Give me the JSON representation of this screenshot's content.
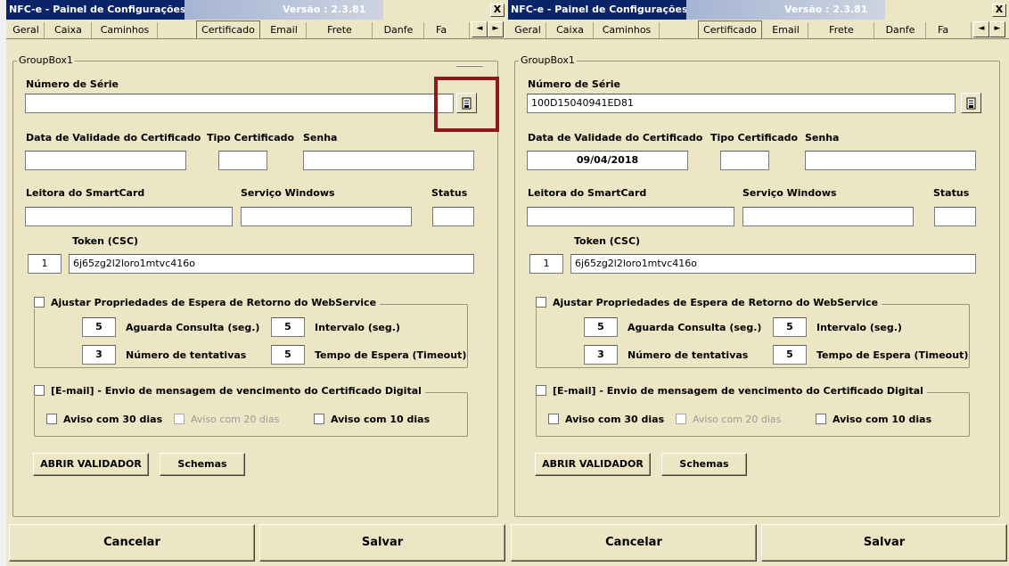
{
  "window": {
    "title": "NFC-e - Painel de Configurações",
    "version": "Versão : 2.3.81",
    "close_label": "X"
  },
  "tabs": [
    "Geral",
    "Caixa",
    "Caminhos",
    "Certificado",
    "Email",
    "Frete",
    "Danfe",
    "Fa"
  ],
  "active_tab": "Certificado",
  "scroll": {
    "left": "◄",
    "right": "►"
  },
  "groupbox": {
    "title": "GroupBox1"
  },
  "labels": {
    "serial_number": "Número de Série",
    "validity": "Data de Validade do Certificado",
    "cert_type": "Tipo Certificado",
    "password": "Senha",
    "smartcard_reader": "Leitora do SmartCard",
    "windows_service": "Serviço Windows",
    "status": "Status",
    "token": "Token (CSC)"
  },
  "webservice": {
    "title": "Ajustar Propriedades de Espera de Retorno do WebService",
    "fields": [
      {
        "label": "Aguarda Consulta (seg.)",
        "value": "5"
      },
      {
        "label": "Intervalo (seg.)",
        "value": "5"
      },
      {
        "label": "Número de tentativas",
        "value": "3"
      },
      {
        "label": "Tempo de Espera (Timeout)",
        "value": "5"
      }
    ]
  },
  "email_section": {
    "title": "[E-mail]  - Envio de mensagem de vencimento do Certificado Digital",
    "options": [
      "Aviso com 30 dias",
      "Aviso com 20 dias",
      "Aviso com 10 dias"
    ]
  },
  "buttons": {
    "validator": "ABRIR VALIDADOR",
    "schemas": "Schemas",
    "cancel": "Cancelar",
    "save": "Salvar"
  },
  "panels": {
    "left": {
      "serial_number": "",
      "validity": "",
      "cert_type": "",
      "password": "",
      "smartcard_reader": "",
      "windows_service": "",
      "status": "",
      "token_id": "1",
      "token_value": "6j65zg2l2loro1mtvc416o"
    },
    "right": {
      "serial_number": "100D15040941ED81",
      "validity": "09/04/2018",
      "cert_type": "",
      "password": "",
      "smartcard_reader": "",
      "windows_service": "",
      "status": "",
      "token_id": "1",
      "token_value": "6j65zg2l2loro1mtvc416o"
    }
  },
  "colors": {
    "panel_bg": "#ece6c4",
    "title_bg": "#0a246a",
    "highlight": "#8b1a1a"
  },
  "icons": {
    "browse_certificate": "certificate-browse-icon"
  }
}
